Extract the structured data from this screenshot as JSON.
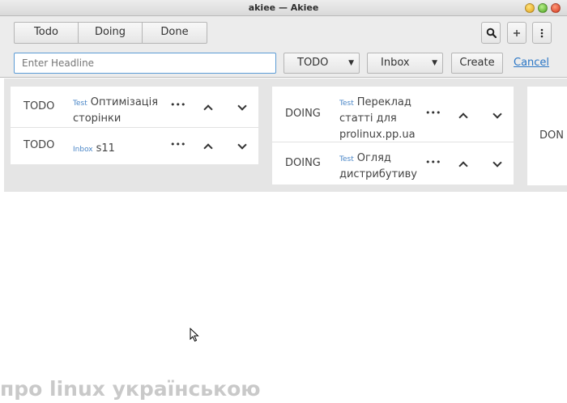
{
  "window": {
    "title": "akiee — Akiee"
  },
  "toolbar": {
    "segments": [
      "Todo",
      "Doing",
      "Done"
    ],
    "search_icon": "search-icon",
    "add_icon": "plus-icon",
    "menu_icon": "vertical-dots-icon"
  },
  "form": {
    "headline_placeholder": "Enter Headline",
    "state_value": "TODO",
    "list_value": "Inbox",
    "create_label": "Create",
    "cancel_label": "Cancel"
  },
  "columns": [
    {
      "cards": [
        {
          "state": "TODO",
          "tag": "Test",
          "title": "Оптимізація сторінки"
        },
        {
          "state": "TODO",
          "tag": "Inbox",
          "title": "s11"
        }
      ]
    },
    {
      "cards": [
        {
          "state": "DOING",
          "tag": "Test",
          "title": "Переклад статті для prolinux.pp.ua"
        },
        {
          "state": "DOING",
          "tag": "Test",
          "title": "Огляд дистрибутиву"
        }
      ]
    }
  ],
  "partial_column_state": "DON",
  "watermark": "про linux українською",
  "colors": {
    "link": "#2a76c6",
    "tag": "#4a86c7",
    "focus": "#5b9bd5"
  }
}
